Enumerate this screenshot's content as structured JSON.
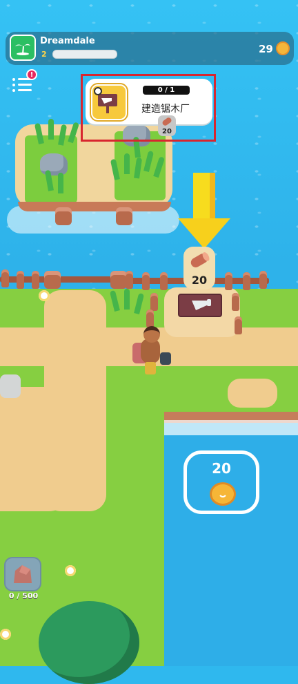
{
  "hud": {
    "island_name": "Dreamdale",
    "level": "2",
    "xp_fraction": 0.0,
    "coins": "29"
  },
  "menu": {
    "notification_badge": "!"
  },
  "quest": {
    "progress": "0 / 1",
    "title": "建造锯木厂",
    "requirement_count": "20"
  },
  "build_site": {
    "wood_needed": "20"
  },
  "coin_pad": {
    "amount": "20"
  },
  "inventory": {
    "stone_count": "0 / 500"
  },
  "colors": {
    "water": "#2fb8ee",
    "grass": "#86cf41",
    "sand": "#f0cc8e",
    "highlight_outline": "#d8262f",
    "arrow": "#f7dc1e",
    "coin": "#f6b637"
  },
  "icons": [
    "palm-island-icon",
    "coin-icon",
    "menu-icon",
    "saw-sign-icon",
    "wood-log-icon",
    "stone-icon",
    "down-arrow-icon"
  ]
}
